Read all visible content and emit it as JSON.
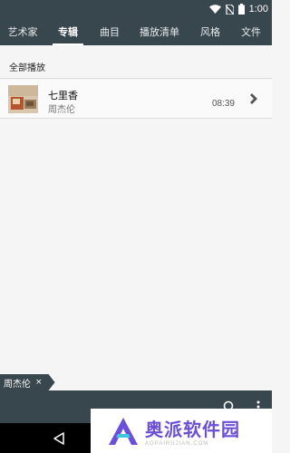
{
  "status_bar": {
    "time": "1:00"
  },
  "tabs": [
    {
      "label": "艺术家",
      "active": false
    },
    {
      "label": "专辑",
      "active": true
    },
    {
      "label": "曲目",
      "active": false
    },
    {
      "label": "播放清单",
      "active": false
    },
    {
      "label": "风格",
      "active": false
    },
    {
      "label": "文件",
      "active": false
    }
  ],
  "section": {
    "play_all_label": "全部播放"
  },
  "albums": [
    {
      "title": "七里香",
      "artist": "周杰伦",
      "duration": "08:39"
    }
  ],
  "filter_chip": {
    "label": "周杰伦",
    "close": "×"
  },
  "watermark": {
    "title": "奥派软件园",
    "subtitle": "AOPAIRUJIAN.COM"
  },
  "colors": {
    "bar_bg": "#38464d",
    "accent": "#6b4fd8"
  }
}
